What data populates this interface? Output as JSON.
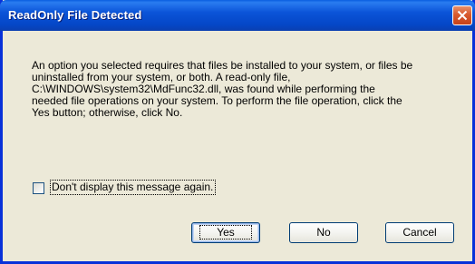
{
  "window": {
    "title": "ReadOnly File Detected"
  },
  "message": {
    "text": "An option you selected requires that files be installed to your system, or files be\nuninstalled from your system, or both. A read-only file,\nC:\\WINDOWS\\system32\\MdFunc32.dll, was found while performing the\nneeded file operations on your system. To perform the file operation, click the\nYes button; otherwise, click No."
  },
  "checkbox": {
    "label": "Don't display this message again.",
    "checked": false
  },
  "buttons": {
    "yes": "Yes",
    "no": "No",
    "cancel": "Cancel"
  },
  "colors": {
    "titlebar": "#0b54d8",
    "dialog_bg": "#ece9d8",
    "close_button": "#d85a2e"
  }
}
